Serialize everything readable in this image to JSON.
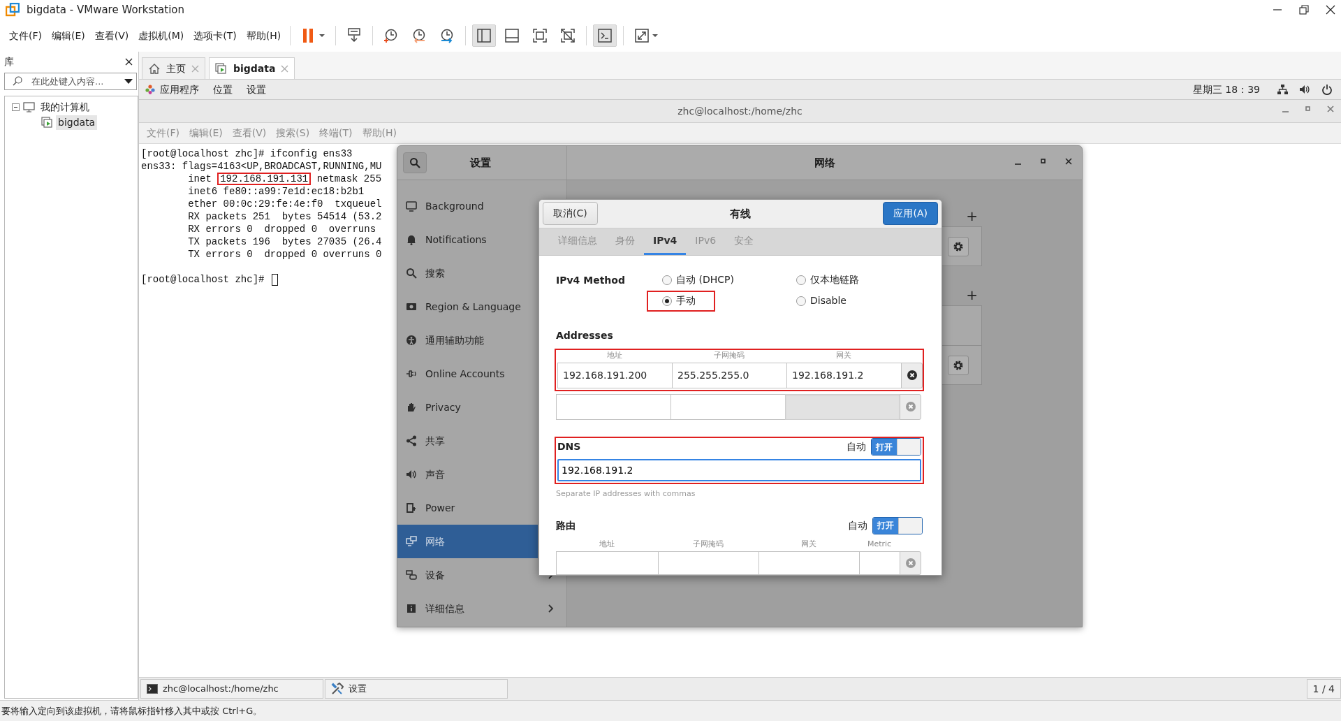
{
  "window": {
    "title": "bigdata - VMware Workstation"
  },
  "menu": [
    "文件(F)",
    "编辑(E)",
    "查看(V)",
    "虚拟机(M)",
    "选项卡(T)",
    "帮助(H)"
  ],
  "toolbar": [
    {
      "pressed": false
    },
    {
      "pressed": false
    },
    {
      "pressed": false
    },
    {
      "pressed": false
    },
    {
      "pressed": false
    },
    {
      "pressed": true
    },
    {
      "pressed": false
    },
    {
      "pressed": false
    },
    {
      "pressed": false
    },
    {
      "pressed": true
    },
    {
      "pressed": false
    }
  ],
  "library": {
    "title": "库",
    "search_placeholder": "在此处键入内容...",
    "tree": [
      {
        "label": "我的计算机",
        "expanded": true,
        "selected": false,
        "children": [
          {
            "label": "bigdata",
            "selected": true
          }
        ]
      }
    ]
  },
  "tabs": [
    {
      "label": "主页",
      "selected": false
    },
    {
      "label": "bigdata",
      "selected": true
    }
  ],
  "top_bar": {
    "menus": [
      "应用程序",
      "位置",
      "设置"
    ],
    "clock": "星期三 18：39"
  },
  "terminal": {
    "title": "zhc@localhost:/home/zhc",
    "menu": [
      "文件(F)",
      "编辑(E)",
      "查看(V)",
      "搜索(S)",
      "终端(T)",
      "帮助(H)"
    ],
    "lines": [
      {
        "gap_before": false,
        "cursor": false,
        "segments": [
          {
            "text": "[root@localhost zhc]# ifconfig ens33",
            "boxed": false
          }
        ]
      },
      {
        "gap_before": false,
        "cursor": false,
        "segments": [
          {
            "text": "ens33: flags=4163<UP,BROADCAST,RUNNING,MU",
            "boxed": false
          }
        ]
      },
      {
        "gap_before": false,
        "cursor": false,
        "segments": [
          {
            "text": "        inet ",
            "boxed": false
          },
          {
            "text": "192.168.191.131",
            "boxed": true
          },
          {
            "text": " netmask 255",
            "boxed": false
          }
        ]
      },
      {
        "gap_before": false,
        "cursor": false,
        "segments": [
          {
            "text": "        inet6 fe80::a99:7e1d:ec18:b2b1",
            "boxed": false
          }
        ]
      },
      {
        "gap_before": false,
        "cursor": false,
        "segments": [
          {
            "text": "        ether 00:0c:29:fe:4e:f0  txqueuel",
            "boxed": false
          }
        ]
      },
      {
        "gap_before": false,
        "cursor": false,
        "segments": [
          {
            "text": "        RX packets 251  bytes 54514 (53.2",
            "boxed": false
          }
        ]
      },
      {
        "gap_before": false,
        "cursor": false,
        "segments": [
          {
            "text": "        RX errors 0  dropped 0  overruns",
            "boxed": false
          }
        ]
      },
      {
        "gap_before": false,
        "cursor": false,
        "segments": [
          {
            "text": "        TX packets 196  bytes 27035 (26.4",
            "boxed": false
          }
        ]
      },
      {
        "gap_before": false,
        "cursor": false,
        "segments": [
          {
            "text": "        TX errors 0  dropped 0 overruns 0",
            "boxed": false
          }
        ]
      },
      {
        "gap_before": true,
        "cursor": true,
        "segments": [
          {
            "text": "[root@localhost zhc]# ",
            "boxed": false
          }
        ]
      }
    ]
  },
  "settings": {
    "title": "设置",
    "panel_title": "网络",
    "sidebar": [
      {
        "label": "Background",
        "selected": false,
        "kind": "page"
      },
      {
        "label": "Notifications",
        "selected": false,
        "kind": "page"
      },
      {
        "label": "搜索",
        "selected": false,
        "kind": "page"
      },
      {
        "label": "Region & Language",
        "selected": false,
        "kind": "page"
      },
      {
        "label": "通用辅助功能",
        "selected": false,
        "kind": "page"
      },
      {
        "label": "Online Accounts",
        "selected": false,
        "kind": "page"
      },
      {
        "label": "Privacy",
        "selected": false,
        "kind": "page"
      },
      {
        "label": "共享",
        "selected": false,
        "kind": "page"
      },
      {
        "label": "声音",
        "selected": false,
        "kind": "page"
      },
      {
        "label": "Power",
        "selected": false,
        "kind": "page"
      },
      {
        "label": "网络",
        "selected": true,
        "kind": "page"
      },
      {
        "label": "设备",
        "selected": false,
        "kind": "submenu"
      },
      {
        "label": "详细信息",
        "selected": false,
        "kind": "submenu"
      }
    ],
    "panel_sections": [
      {
        "add_label": "+",
        "cards": [
          {
            "kind": "gear"
          }
        ]
      },
      {
        "add_label": "+",
        "cards": [
          {
            "kind": "blank"
          },
          {
            "kind": "gear"
          }
        ]
      }
    ]
  },
  "dialog": {
    "cancel": "取消(C)",
    "title": "有线",
    "apply": "应用(A)",
    "tabs": [
      {
        "label": "详细信息",
        "selected": false
      },
      {
        "label": "身份",
        "selected": false
      },
      {
        "label": "IPv4",
        "selected": true
      },
      {
        "label": "IPv6",
        "selected": false
      },
      {
        "label": "安全",
        "selected": false
      }
    ],
    "method_label": "IPv4 Method",
    "methods": [
      {
        "label": "自动 (DHCP)",
        "selected": false,
        "annotated": false
      },
      {
        "label": "仅本地链路",
        "selected": false,
        "annotated": false
      },
      {
        "label": "手动",
        "selected": true,
        "annotated": true
      },
      {
        "label": "Disable",
        "selected": false,
        "annotated": false
      }
    ],
    "addresses": {
      "title": "Addresses",
      "annotated": true,
      "columns": [
        "地址",
        "子网掩码",
        "网关"
      ],
      "rows": [
        {
          "delete_enabled": true,
          "cells": [
            {
              "value": "192.168.191.200",
              "disabled": false
            },
            {
              "value": "255.255.255.0",
              "disabled": false
            },
            {
              "value": "192.168.191.2",
              "disabled": false
            }
          ]
        },
        {
          "delete_enabled": false,
          "cells": [
            {
              "disabled": false
            },
            {
              "disabled": false
            },
            {
              "disabled": true
            }
          ]
        }
      ]
    },
    "dns": {
      "title": "DNS",
      "annotated": true,
      "auto_label": "自动",
      "auto": true,
      "toggle_label": "打开",
      "value": "192.168.191.2",
      "hint": "Separate IP addresses with commas"
    },
    "routes": {
      "title": "路由",
      "auto_label": "自动",
      "auto": true,
      "toggle_label": "打开",
      "columns": [
        "地址",
        "子网掩码",
        "网关",
        "Metric"
      ]
    }
  },
  "taskbar": {
    "items": [
      {
        "label": "zhc@localhost:/home/zhc",
        "kind": "terminal"
      },
      {
        "label": "设置",
        "kind": "settings"
      }
    ],
    "workspace": "1 / 4"
  },
  "status_bar": "要将输入定向到该虚拟机，请将鼠标指针移入其中或按 Ctrl+G。"
}
